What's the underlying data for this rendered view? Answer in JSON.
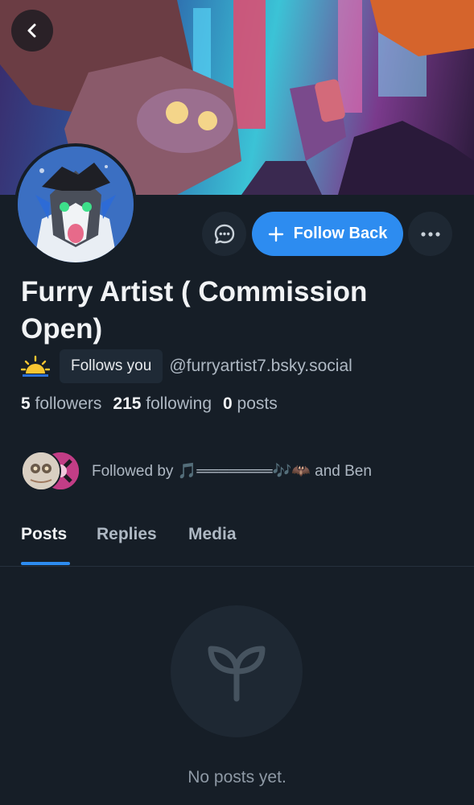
{
  "header": {
    "back_icon": "chevron-left-icon"
  },
  "profile": {
    "display_name": "Furry Artist ( Commission Open)",
    "status_emoji": "sunrise-icon",
    "follows_you_badge": "Follows you",
    "handle": "@furryartist7.bsky.social",
    "stats": {
      "followers_count": "5",
      "followers_label": "followers",
      "following_count": "215",
      "following_label": "following",
      "posts_count": "0",
      "posts_label": "posts"
    },
    "followed_by_text": "Followed by 🎵═══════🎶🦇 and Ben"
  },
  "actions": {
    "message_icon": "chat-bubble-icon",
    "follow_label": "Follow Back",
    "follow_icon": "plus-icon",
    "more_icon": "ellipsis-icon"
  },
  "tabs": [
    {
      "label": "Posts",
      "active": true
    },
    {
      "label": "Replies",
      "active": false
    },
    {
      "label": "Media",
      "active": false
    }
  ],
  "empty_state": {
    "icon": "sprout-icon",
    "message": "No posts yet."
  },
  "colors": {
    "background": "#161e27",
    "accent": "#2d8cf0",
    "muted_text": "#aeb8c3",
    "surface": "#1e2833"
  }
}
